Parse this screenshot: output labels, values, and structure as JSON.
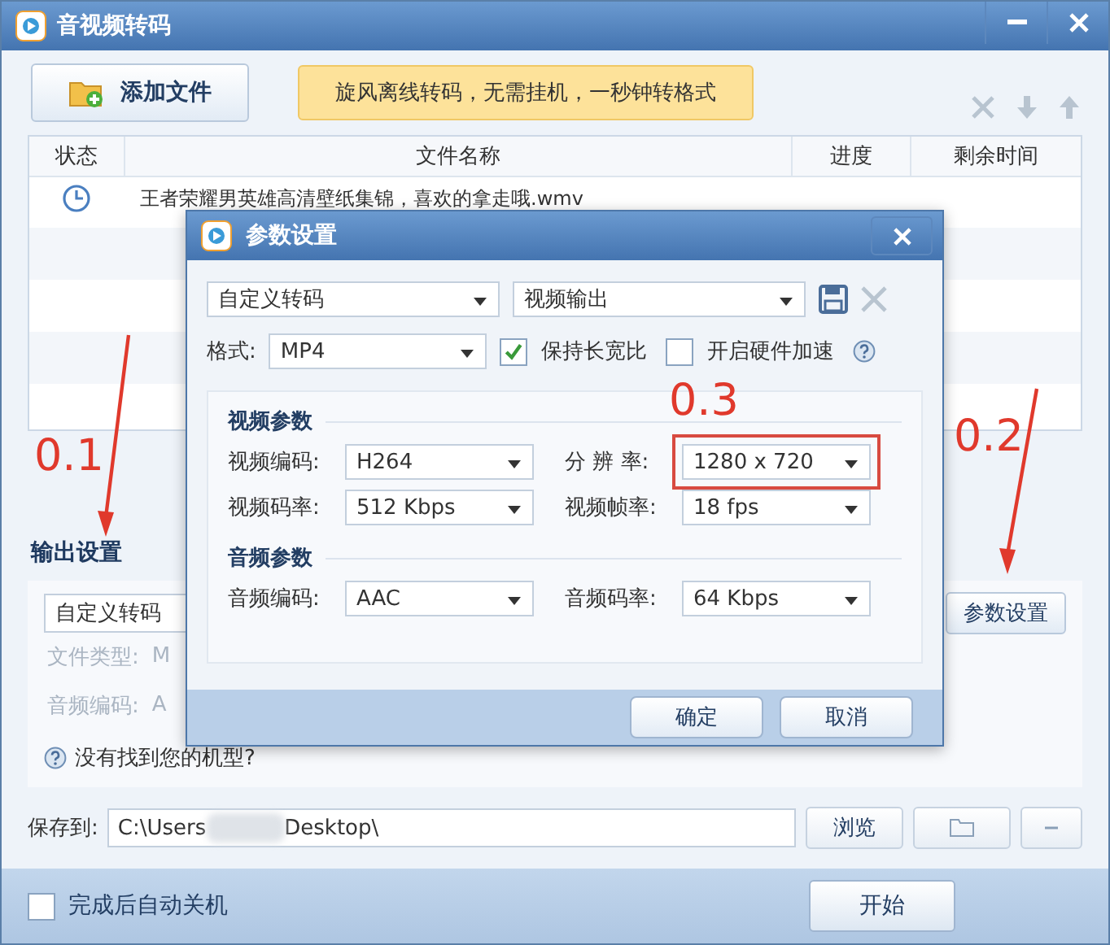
{
  "window": {
    "title": "音视频转码"
  },
  "toolbar": {
    "add_button": "添加文件",
    "banner": "旋风离线转码，无需挂机，一秒钟转格式"
  },
  "table": {
    "columns": [
      "状态",
      "文件名称",
      "进度",
      "剩余时间"
    ],
    "rows": [
      {
        "kind": "waiting",
        "name": "王者荣耀男英雄高清壁纸集锦，喜欢的拿走哦.wmv"
      }
    ]
  },
  "output_settings": {
    "title": "输出设置",
    "preset": "自定义转码",
    "params_button": "参数设置",
    "fields": [
      {
        "label": "文件类型:",
        "value": "M"
      },
      {
        "label": "音频编码:",
        "value": "A"
      }
    ],
    "help": "没有找到您的机型?"
  },
  "save": {
    "label": "保存到:",
    "path_start": "C:\\Users",
    "path_end": "Desktop\\",
    "browse_button": "浏览"
  },
  "bottom": {
    "shutdown_label": "完成后自动关机",
    "shutdown_checked": false,
    "start_button": "开始"
  },
  "dialog": {
    "title": "参数设置",
    "preset": "自定义转码",
    "output": "视频输出",
    "format_label": "格式:",
    "format": "MP4",
    "options": [
      {
        "label": "保持长宽比",
        "checked": true
      },
      {
        "label": "开启硬件加速",
        "checked": false
      }
    ],
    "sections": [
      {
        "title": "视频参数",
        "fields": [
          {
            "label": "视频编码:",
            "value": "H264",
            "highlighted": false
          },
          {
            "label": "分 辨 率:",
            "value": "1280 x 720",
            "highlighted": true
          },
          {
            "label": "视频码率:",
            "value": "512 Kbps",
            "highlighted": false
          },
          {
            "label": "视频帧率:",
            "value": "18 fps",
            "highlighted": false
          }
        ]
      },
      {
        "title": "音频参数",
        "fields": [
          {
            "label": "音频编码:",
            "value": "AAC",
            "highlighted": false
          },
          {
            "label": "音频码率:",
            "value": "64 Kbps",
            "highlighted": false
          }
        ]
      }
    ],
    "buttons": [
      "确定",
      "取消"
    ]
  },
  "annotations": [
    {
      "label": "0.1"
    },
    {
      "label": "0.2"
    },
    {
      "label": "0.3"
    }
  ]
}
